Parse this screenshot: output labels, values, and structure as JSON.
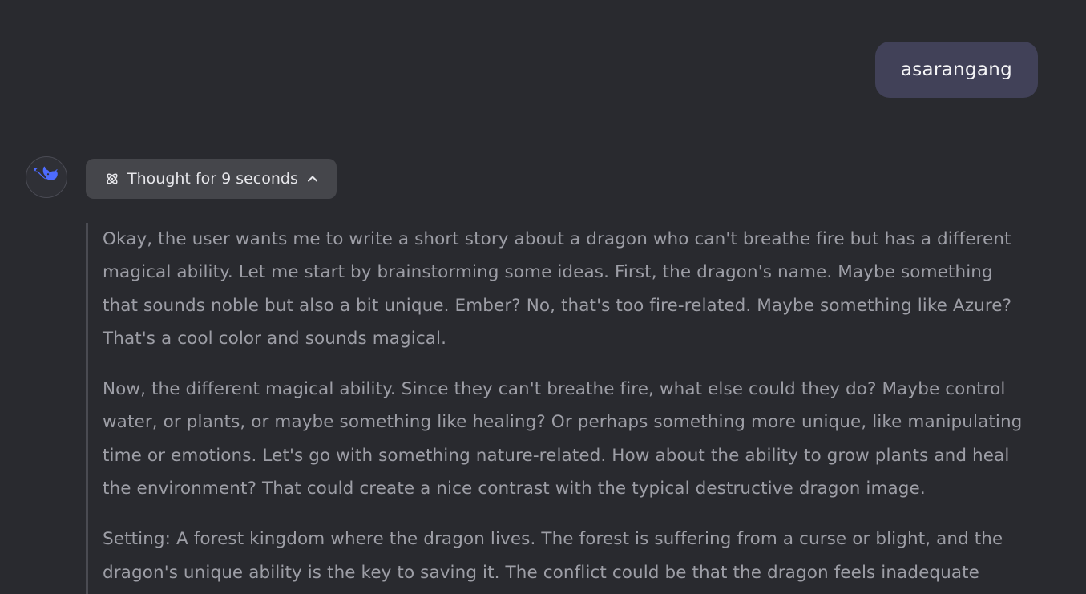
{
  "user_message": {
    "text": "asarangang"
  },
  "assistant": {
    "avatar_icon": "whale-logo-icon",
    "accent_color": "#4d6bfe",
    "thought_toggle": {
      "icon": "atom-icon",
      "label": "Thought for 9 seconds",
      "chevron_icon": "chevron-up-icon"
    },
    "thinking_paragraphs": [
      "Okay, the user wants me to write a short story about a dragon who can't breathe fire but has a different magical ability. Let me start by brainstorming some ideas. First, the dragon's name. Maybe something that sounds noble but also a bit unique. Ember? No, that's too fire-related. Maybe something like Azure? That's a cool color and sounds magical.",
      "Now, the different magical ability. Since they can't breathe fire, what else could they do? Maybe control water, or plants, or maybe something like healing? Or perhaps something more unique, like manipulating time or emotions. Let's go with something nature-related. How about the ability to grow plants and heal the environment? That could create a nice contrast with the typical destructive dragon image.",
      "Setting: A forest kingdom where the dragon lives. The forest is suffering from a curse or blight, and the dragon's unique ability is the key to saving it. The conflict could be that the dragon feels inadequate"
    ]
  }
}
